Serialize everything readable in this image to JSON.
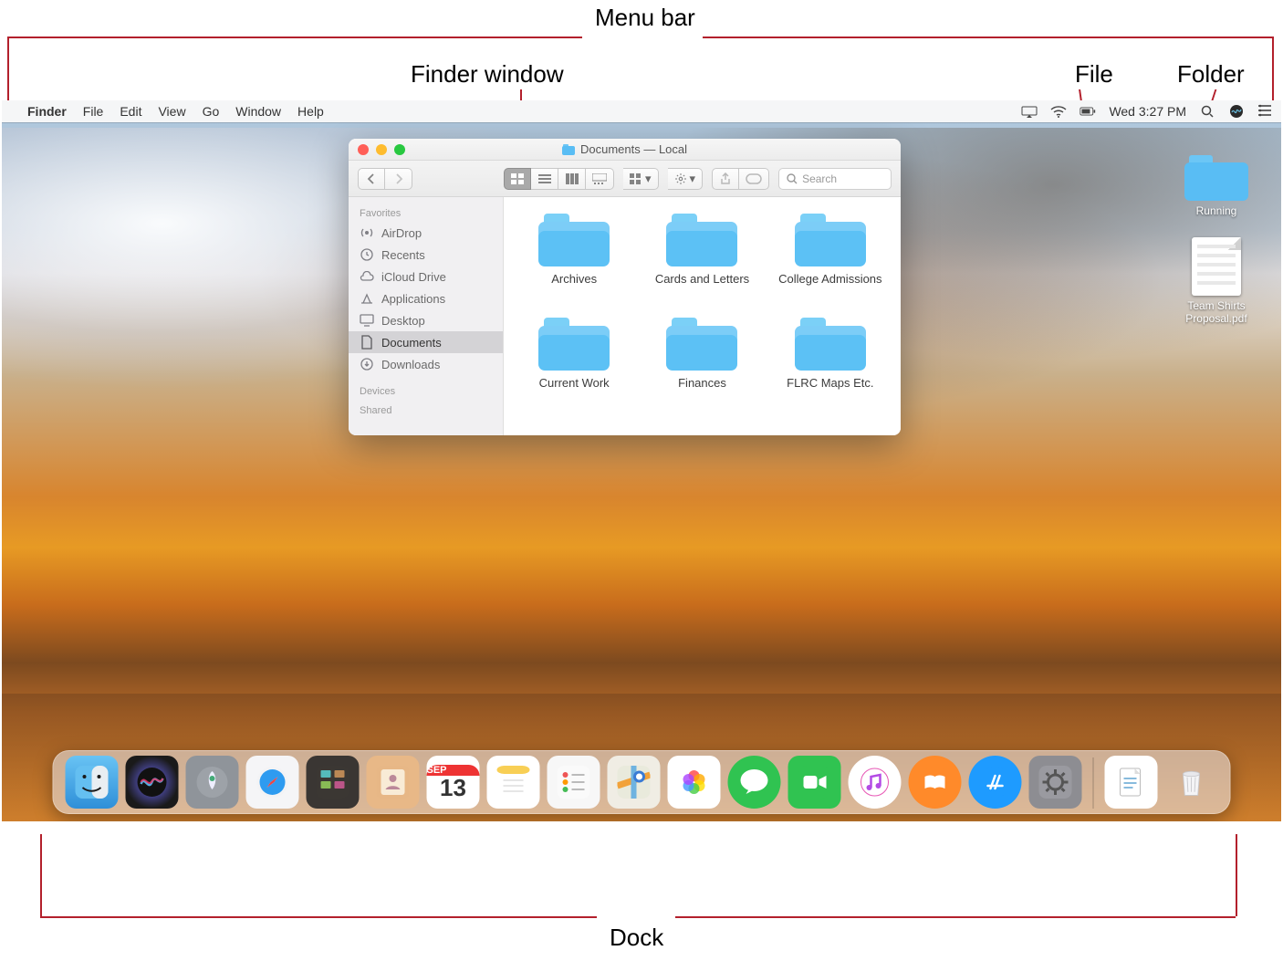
{
  "annotations": {
    "menubar": "Menu bar",
    "finder_window": "Finder window",
    "file": "File",
    "folder": "Folder",
    "dock": "Dock"
  },
  "menubar": {
    "app_name": "Finder",
    "menus": [
      "File",
      "Edit",
      "View",
      "Go",
      "Window",
      "Help"
    ],
    "status_time": "Wed 3:27 PM"
  },
  "desktop_icons": {
    "folder": {
      "label": "Running"
    },
    "file": {
      "label": "Team Shirts Proposal.pdf"
    }
  },
  "finder": {
    "title": "Documents — Local",
    "search_placeholder": "Search",
    "sidebar": {
      "favorites_header": "Favorites",
      "favorites": [
        "AirDrop",
        "Recents",
        "iCloud Drive",
        "Applications",
        "Desktop",
        "Documents",
        "Downloads"
      ],
      "devices_header": "Devices",
      "shared_header": "Shared",
      "selected_index": 5
    },
    "folders": [
      "Archives",
      "Cards and Letters",
      "College Admissions",
      "Current Work",
      "Finances",
      "FLRC Maps Etc."
    ]
  },
  "dock": {
    "calendar_month": "SEP",
    "calendar_day": "13",
    "apps": [
      "Finder",
      "Siri",
      "Launchpad",
      "Safari",
      "Mission Control",
      "Contacts",
      "Calendar",
      "Notes",
      "Reminders",
      "Maps",
      "Photos",
      "Messages",
      "FaceTime",
      "iTunes",
      "iBooks",
      "App Store",
      "System Preferences"
    ],
    "right": [
      "Documents",
      "Trash"
    ]
  }
}
